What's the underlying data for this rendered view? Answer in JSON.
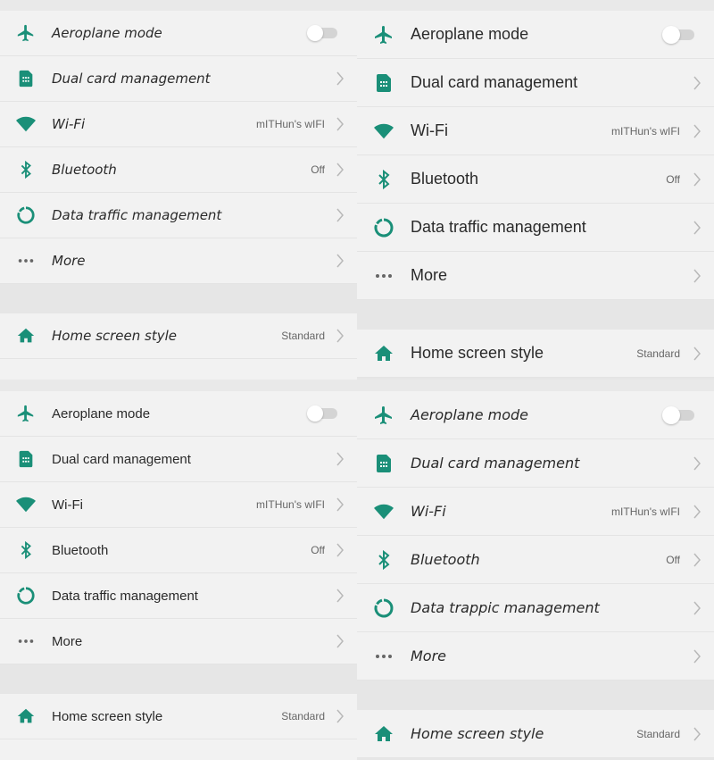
{
  "colors": {
    "accent": "#1a8f78",
    "chevron": "#b8b8b8",
    "row_bg": "#f2f2f2",
    "section_gap": "#e6e6e6",
    "toggle_off": "#d4d4d4"
  },
  "panels": [
    {
      "id": "top-left",
      "items": [
        {
          "icon": "airplane-icon",
          "label": "Aeroplane mode",
          "control": "toggle",
          "toggle_on": false
        },
        {
          "icon": "sim-card-icon",
          "label": "Dual card management",
          "control": "chevron"
        },
        {
          "icon": "wifi-icon",
          "label": "Wi-Fi",
          "value": "mITHun's wIFI",
          "control": "chevron"
        },
        {
          "icon": "bluetooth-icon",
          "label": "Bluetooth",
          "value": "Off",
          "control": "chevron"
        },
        {
          "icon": "data-traffic-icon",
          "label": "Data traffic management",
          "control": "chevron"
        },
        {
          "icon": "more-dots-icon",
          "label": "More",
          "control": "chevron"
        }
      ],
      "section2": [
        {
          "icon": "home-icon",
          "label": "Home screen style",
          "value": "Standard",
          "control": "chevron"
        }
      ]
    },
    {
      "id": "top-right",
      "items": [
        {
          "icon": "airplane-icon",
          "label": "Aeroplane mode",
          "control": "toggle",
          "toggle_on": false
        },
        {
          "icon": "sim-card-icon",
          "label": "Dual card management",
          "control": "chevron"
        },
        {
          "icon": "wifi-icon",
          "label": "Wi-Fi",
          "value": "mITHun's wIFI",
          "control": "chevron"
        },
        {
          "icon": "bluetooth-icon",
          "label": "Bluetooth",
          "value": "Off",
          "control": "chevron"
        },
        {
          "icon": "data-traffic-icon",
          "label": "Data traffic management",
          "control": "chevron"
        },
        {
          "icon": "more-dots-icon",
          "label": "More",
          "control": "chevron"
        }
      ],
      "section2": [
        {
          "icon": "home-icon",
          "label": "Home screen style",
          "value": "Standard",
          "control": "chevron"
        }
      ]
    },
    {
      "id": "bottom-left",
      "items": [
        {
          "icon": "airplane-icon",
          "label": "Aeroplane mode",
          "control": "toggle",
          "toggle_on": false
        },
        {
          "icon": "sim-card-icon",
          "label": "Dual card management",
          "control": "chevron"
        },
        {
          "icon": "wifi-icon",
          "label": "Wi-Fi",
          "value": "mITHun's wIFI",
          "control": "chevron"
        },
        {
          "icon": "bluetooth-icon",
          "label": "Bluetooth",
          "value": "Off",
          "control": "chevron"
        },
        {
          "icon": "data-traffic-icon",
          "label": "Data traffic management",
          "control": "chevron"
        },
        {
          "icon": "more-dots-icon",
          "label": "More",
          "control": "chevron"
        }
      ],
      "section2": [
        {
          "icon": "home-icon",
          "label": "Home screen style",
          "value": "Standard",
          "control": "chevron"
        }
      ]
    },
    {
      "id": "bottom-right",
      "items": [
        {
          "icon": "airplane-icon",
          "label": "Aeroplane mode",
          "control": "toggle",
          "toggle_on": false
        },
        {
          "icon": "sim-card-icon",
          "label": "Dual card management",
          "control": "chevron"
        },
        {
          "icon": "wifi-icon",
          "label": "Wi-Fi",
          "value": "mITHun's wIFI",
          "control": "chevron"
        },
        {
          "icon": "bluetooth-icon",
          "label": "Bluetooth",
          "value": "Off",
          "control": "chevron"
        },
        {
          "icon": "data-traffic-icon",
          "label": "Data trappic management",
          "control": "chevron"
        },
        {
          "icon": "more-dots-icon",
          "label": "More",
          "control": "chevron"
        }
      ],
      "section2": [
        {
          "icon": "home-icon",
          "label": "Home screen style",
          "value": "Standard",
          "control": "chevron"
        }
      ]
    }
  ]
}
